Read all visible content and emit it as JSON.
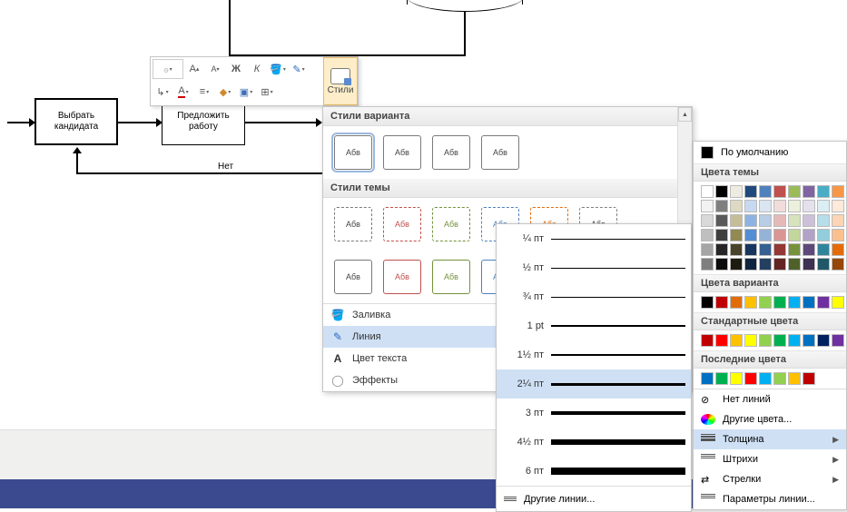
{
  "flowchart": {
    "box1": "Выбрать\nкандидата",
    "box2": "Предложить\nработу",
    "label_no": "Нет"
  },
  "mini_toolbar": {
    "styles_label": "Стили"
  },
  "styles_panel": {
    "header1": "Стили варианта",
    "header2": "Стили темы",
    "thumb_label": "Абв",
    "menu": {
      "fill": "Заливка",
      "line": "Линия",
      "text_color": "Цвет текста",
      "effects": "Эффекты"
    }
  },
  "weight_panel": {
    "rows": [
      {
        "label": "¼ пт",
        "h": 0.5
      },
      {
        "label": "½ пт",
        "h": 0.75
      },
      {
        "label": "¾ пт",
        "h": 1
      },
      {
        "label": "1 pt",
        "h": 1.3
      },
      {
        "label": "1½ пт",
        "h": 2
      },
      {
        "label": "2¼ пт",
        "h": 3
      },
      {
        "label": "3 пт",
        "h": 4
      },
      {
        "label": "4½ пт",
        "h": 6
      },
      {
        "label": "6 пт",
        "h": 8
      }
    ],
    "footer": "Другие линии..."
  },
  "color_panel": {
    "default": "По умолчанию",
    "theme_header": "Цвета темы",
    "variant_header": "Цвета варианта",
    "standard_header": "Стандартные цвета",
    "recent_header": "Последние цвета",
    "no_line": "Нет линий",
    "more_colors": "Другие цвета...",
    "weight": "Толщина",
    "dashes": "Штрихи",
    "arrows": "Стрелки",
    "line_params": "Параметры линии...",
    "theme_colors": [
      [
        "#ffffff",
        "#000000",
        "#eeece1",
        "#1f497d",
        "#4f81bd",
        "#c0504d",
        "#9bbb59",
        "#8064a2",
        "#4bacc6",
        "#f79646"
      ],
      [
        "#f2f2f2",
        "#7f7f7f",
        "#ddd9c3",
        "#c6d9f0",
        "#dbe5f1",
        "#f2dcdb",
        "#ebf1dd",
        "#e5e0ec",
        "#dbeef3",
        "#fdeada"
      ],
      [
        "#d8d8d8",
        "#595959",
        "#c4bd97",
        "#8db3e2",
        "#b8cce4",
        "#e5b9b7",
        "#d7e3bc",
        "#ccc1d9",
        "#b7dde8",
        "#fbd5b5"
      ],
      [
        "#bfbfbf",
        "#3f3f3f",
        "#938953",
        "#548dd4",
        "#95b3d7",
        "#d99694",
        "#c3d69b",
        "#b2a2c7",
        "#92cddc",
        "#fac08f"
      ],
      [
        "#a5a5a5",
        "#262626",
        "#494429",
        "#17365d",
        "#366092",
        "#953734",
        "#76923c",
        "#5f497a",
        "#31859b",
        "#e36c09"
      ],
      [
        "#7f7f7f",
        "#0c0c0c",
        "#1d1b10",
        "#0f243e",
        "#244061",
        "#632423",
        "#4f6128",
        "#3f3151",
        "#205867",
        "#974806"
      ]
    ],
    "variant_colors": [
      "#000000",
      "#c00000",
      "#e36c0a",
      "#ffc000",
      "#92d050",
      "#00b050",
      "#00b0f0",
      "#0070c0",
      "#7030a0",
      "#ffff00"
    ],
    "standard_colors": [
      "#c00000",
      "#ff0000",
      "#ffc000",
      "#ffff00",
      "#92d050",
      "#00b050",
      "#00b0f0",
      "#0070c0",
      "#002060",
      "#7030a0"
    ],
    "recent_colors": [
      "#0070c0",
      "#00b050",
      "#ffff00",
      "#ff0000",
      "#00b0f0",
      "#92d050",
      "#ffc000",
      "#c00000"
    ]
  }
}
